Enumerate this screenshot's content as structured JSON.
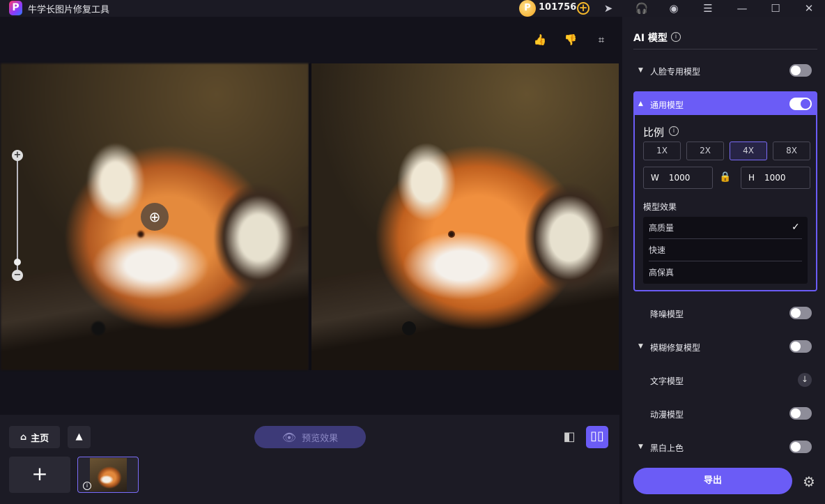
{
  "app": {
    "title": "牛学长图片修复工具",
    "logo_letter": "P",
    "coin_letter": "P",
    "coins": "101756"
  },
  "canvas": {
    "magnifier_icon": "zoom-in-icon"
  },
  "bottom": {
    "home_label": "主页",
    "preview_label": "预览效果"
  },
  "panel": {
    "title": "AI 模型",
    "face_model": "人脸专用模型",
    "general_model": "通用模型",
    "scale_label": "比例",
    "scales": [
      "1X",
      "2X",
      "4X",
      "8X"
    ],
    "selected_scale": "4X",
    "width_label": "W",
    "width_value": "1000",
    "height_label": "H",
    "height_value": "1000",
    "effect_label": "模型效果",
    "effects": [
      "高质量",
      "快速",
      "高保真"
    ],
    "selected_effect": "高质量",
    "denoise_model": "降噪模型",
    "deblur_model": "模糊修复模型",
    "text_model": "文字模型",
    "anime_model": "动漫模型",
    "colorize": "黑白上色",
    "export_label": "导出"
  },
  "toggles": {
    "face": false,
    "general": true,
    "denoise": false,
    "deblur": false,
    "anime": false,
    "colorize": false
  },
  "colors": {
    "accent": "#6b5cf6",
    "background": "#13121b",
    "panel": "#1c1b25",
    "coin": "#f5b82a"
  }
}
